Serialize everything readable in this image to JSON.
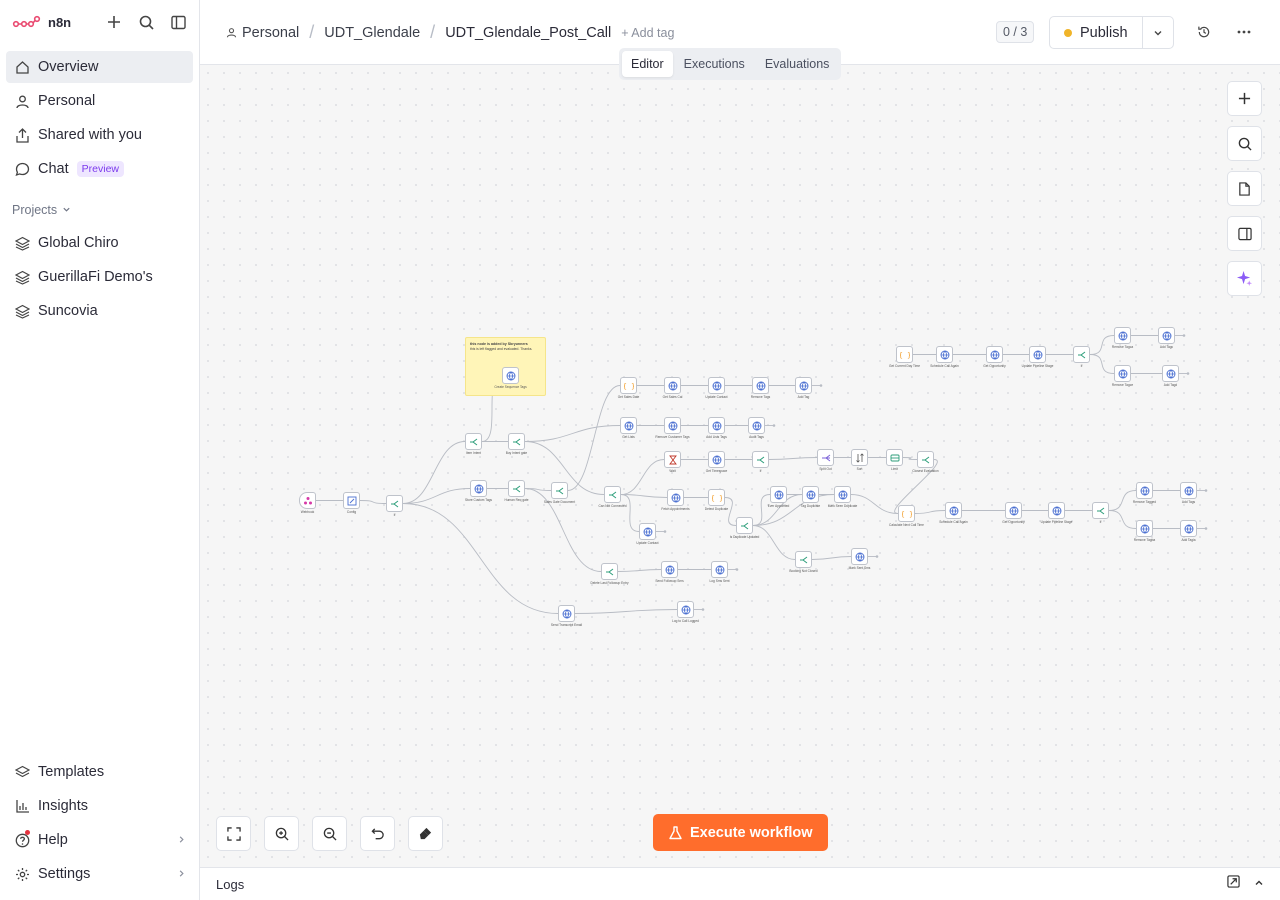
{
  "app": {
    "name": "n8n"
  },
  "sidebar": {
    "main": [
      {
        "label": "Overview",
        "icon": "home-icon"
      },
      {
        "label": "Personal",
        "icon": "user-icon"
      },
      {
        "label": "Shared with you",
        "icon": "share-icon"
      },
      {
        "label": "Chat",
        "icon": "chat-icon",
        "badge": "Preview"
      }
    ],
    "projects_title": "Projects",
    "projects": [
      {
        "label": "Global Chiro",
        "icon": "layers-icon"
      },
      {
        "label": "GuerillaFi Demo's",
        "icon": "layers-icon"
      },
      {
        "label": "Suncovia",
        "icon": "layers-icon"
      }
    ],
    "bottom": [
      {
        "label": "Templates",
        "icon": "templates-icon"
      },
      {
        "label": "Insights",
        "icon": "chart-icon"
      },
      {
        "label": "Help",
        "icon": "help-icon"
      },
      {
        "label": "Settings",
        "icon": "gear-icon"
      }
    ]
  },
  "header": {
    "breadcrumb": [
      "Personal",
      "UDT_Glendale",
      "UDT_Glendale_Post_Call"
    ],
    "add_tag": "+ Add tag",
    "counter": "0 / 3",
    "publish": "Publish"
  },
  "tabs": [
    "Editor",
    "Executions",
    "Evaluations"
  ],
  "canvas": {
    "execute": "Execute workflow",
    "sticky": {
      "title": "this node is added by Sbryunners",
      "body": "this is left flagged and evaluated. Thanks."
    },
    "nodes": [
      {
        "id": "n1",
        "label": "Webhook",
        "type": "trigger"
      },
      {
        "id": "n2",
        "label": "Config",
        "type": "edit"
      },
      {
        "id": "n3",
        "label": "If",
        "type": "if"
      },
      {
        "id": "n4",
        "label": "Item Intent",
        "type": "if"
      },
      {
        "id": "n5",
        "label": "Store Custom Tags",
        "type": "http"
      },
      {
        "id": "n6",
        "label": "Create Sequence Tags",
        "type": "http"
      },
      {
        "id": "n7",
        "label": "Buy Intent gate",
        "type": "if"
      },
      {
        "id": "n8",
        "label": "Human Req gate",
        "type": "if"
      },
      {
        "id": "n9",
        "label": "Get Sales Date",
        "type": "code"
      },
      {
        "id": "n10",
        "label": "Get Sales Cal",
        "type": "http"
      },
      {
        "id": "n11",
        "label": "Update Contact",
        "type": "http"
      },
      {
        "id": "n12",
        "label": "Remove Tags",
        "type": "http"
      },
      {
        "id": "n13",
        "label": "Add Tag",
        "type": "http"
      },
      {
        "id": "n14",
        "label": "Sales Gate Document",
        "type": "if"
      },
      {
        "id": "n15",
        "label": "Get Lists",
        "type": "http"
      },
      {
        "id": "n16",
        "label": "Remove Customer Tags",
        "type": "http"
      },
      {
        "id": "n17",
        "label": "Add Lists Tags",
        "type": "http"
      },
      {
        "id": "n18",
        "label": "Audit Tags",
        "type": "http"
      },
      {
        "id": "n19",
        "label": "Wait",
        "type": "wait"
      },
      {
        "id": "n20",
        "label": "Get Timespace",
        "type": "http"
      },
      {
        "id": "n21",
        "label": "If",
        "type": "if"
      },
      {
        "id": "n22",
        "label": "Split Out",
        "type": "split"
      },
      {
        "id": "n23",
        "label": "Sort",
        "type": "sort"
      },
      {
        "id": "n24",
        "label": "Limit",
        "type": "limit"
      },
      {
        "id": "n25",
        "label": "Closest Evaluation",
        "type": "if"
      },
      {
        "id": "n26",
        "label": "Can Not Connected",
        "type": "if"
      },
      {
        "id": "n27",
        "label": "Fetch Appointments",
        "type": "http"
      },
      {
        "id": "n28",
        "label": "Detect Duplicate",
        "type": "code"
      },
      {
        "id": "n29",
        "label": "Is Duplicate Updated",
        "type": "if"
      },
      {
        "id": "n30",
        "label": "Ever Appointed",
        "type": "http"
      },
      {
        "id": "n31",
        "label": "Tag Duplicate",
        "type": "http"
      },
      {
        "id": "n32",
        "label": "Mark Seen Duplicate",
        "type": "http"
      },
      {
        "id": "n33",
        "label": "Calculate Next Call Time",
        "type": "code"
      },
      {
        "id": "n34",
        "label": "Schedule Call Again",
        "type": "http"
      },
      {
        "id": "n35",
        "label": "Get Opportunity",
        "type": "http"
      },
      {
        "id": "n36",
        "label": "Update Pipeline Stage",
        "type": "http"
      },
      {
        "id": "n37",
        "label": "If",
        "type": "if"
      },
      {
        "id": "n38",
        "label": "Remove Tagged",
        "type": "http"
      },
      {
        "id": "n39",
        "label": "Add Tags",
        "type": "http"
      },
      {
        "id": "n40",
        "label": "Remove Tagba",
        "type": "http"
      },
      {
        "id": "n41",
        "label": "Add Tagia",
        "type": "http"
      },
      {
        "id": "n42",
        "label": "Update Contact",
        "type": "http"
      },
      {
        "id": "n43",
        "label": "Delete Last Followup Entry",
        "type": "if"
      },
      {
        "id": "n44",
        "label": "Send Followup Sms",
        "type": "http"
      },
      {
        "id": "n45",
        "label": "Log Sms Sent",
        "type": "http"
      },
      {
        "id": "n46",
        "label": "Booking Not Closed",
        "type": "if"
      },
      {
        "id": "n47",
        "label": "Mark Sent Sms",
        "type": "http"
      },
      {
        "id": "n48",
        "label": "Send Transcript Email",
        "type": "http"
      },
      {
        "id": "n49",
        "label": "Log to Call Logged",
        "type": "http"
      },
      {
        "id": "n50",
        "label": "Get Current Day Time",
        "type": "code"
      },
      {
        "id": "n51",
        "label": "Schedule Call Again",
        "type": "http"
      },
      {
        "id": "n52",
        "label": "Get Opportunity",
        "type": "http"
      },
      {
        "id": "n53",
        "label": "Update Pipeline Stage",
        "type": "http"
      },
      {
        "id": "n54",
        "label": "If",
        "type": "if"
      },
      {
        "id": "n55",
        "label": "Remove Tagca",
        "type": "http"
      },
      {
        "id": "n56",
        "label": "Add Tagc",
        "type": "http"
      },
      {
        "id": "n57",
        "label": "Remove Tagce",
        "type": "http"
      },
      {
        "id": "n58",
        "label": "Add Tagd",
        "type": "http"
      }
    ]
  },
  "logs": {
    "label": "Logs"
  },
  "colors": {
    "accent": "#ff6d2c",
    "publish_dot": "#f0b429",
    "brand": "#ea4b71",
    "preview": "#7c3aed"
  }
}
